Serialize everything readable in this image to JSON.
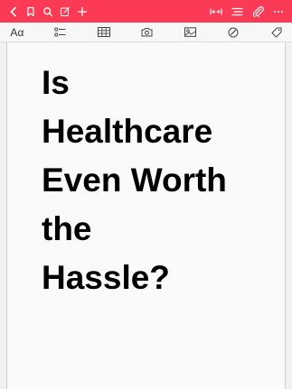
{
  "colors": {
    "accent": "#fb3a55",
    "toolbar_bg": "#f7f7f7",
    "paper": "#fafafa"
  },
  "topbar": {
    "left_icons": [
      "back-icon",
      "bookmark-icon",
      "search-icon",
      "compose-icon",
      "add-icon"
    ],
    "right_icons": [
      "collapse-icon",
      "list-icon",
      "attach-icon",
      "more-icon"
    ]
  },
  "toolbar": {
    "font_label": "Aα",
    "icons": [
      "checklist-icon",
      "table-icon",
      "camera-icon",
      "media-icon",
      "sketch-icon",
      "tag-icon"
    ]
  },
  "note": {
    "title_lines": [
      "Is",
      "Healthcare",
      "Even Worth",
      "the",
      "Hassle?"
    ]
  }
}
